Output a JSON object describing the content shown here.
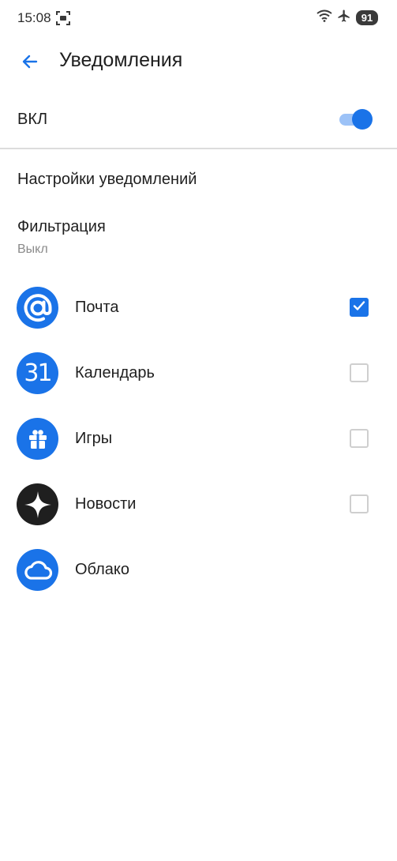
{
  "status_bar": {
    "time": "15:08",
    "battery": "91",
    "icons": [
      "screen-record-icon",
      "wifi-icon",
      "airplane-icon",
      "battery-icon"
    ]
  },
  "app_bar": {
    "title": "Уведомления",
    "back_icon": "arrow-left-icon"
  },
  "main_toggle": {
    "label": "ВКЛ",
    "enabled": true
  },
  "section": {
    "heading": "Настройки уведомлений"
  },
  "filter": {
    "title": "Фильтрация",
    "value": "Выкл"
  },
  "apps": [
    {
      "label": "Почта",
      "icon": "mail-at-icon",
      "color": "#1a73e8",
      "checked": true
    },
    {
      "label": "Календарь",
      "icon": "calendar-icon",
      "icon_text": "31",
      "color": "#1a73e8",
      "checked": false
    },
    {
      "label": "Игры",
      "icon": "gift-icon",
      "color": "#1a73e8",
      "checked": false
    },
    {
      "label": "Новости",
      "icon": "sparkle-icon",
      "color": "#1f1f1f",
      "checked": false
    },
    {
      "label": "Облако",
      "icon": "cloud-icon",
      "color": "#1a73e8"
    }
  ],
  "colors": {
    "accent": "#1a73e8",
    "accent_light": "#9cc2f7"
  }
}
